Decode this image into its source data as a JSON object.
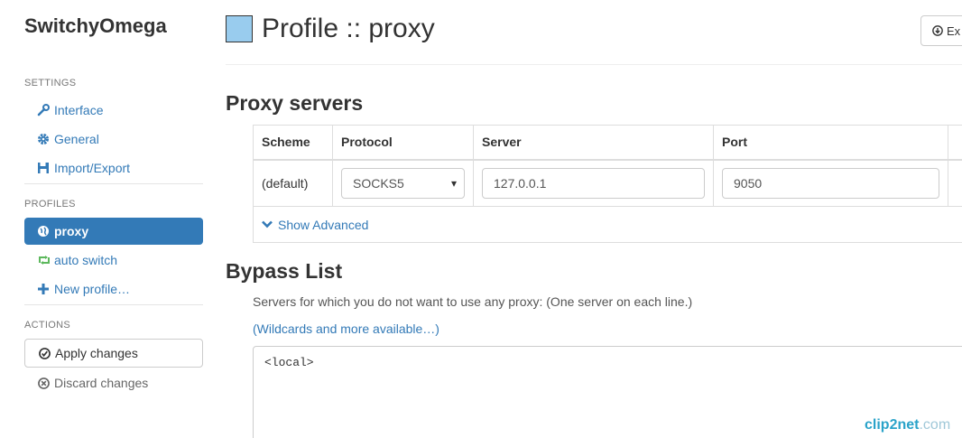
{
  "sidebar": {
    "brand": "SwitchyOmega",
    "settings_header": "SETTINGS",
    "settings_items": [
      {
        "label": "Interface",
        "icon": "wrench-icon"
      },
      {
        "label": "General",
        "icon": "gear-icon"
      },
      {
        "label": "Import/Export",
        "icon": "floppy-icon"
      }
    ],
    "profiles_header": "PROFILES",
    "profiles_items": [
      {
        "label": "proxy",
        "icon": "globe-icon",
        "active": true
      },
      {
        "label": "auto switch",
        "icon": "retweet-icon"
      },
      {
        "label": "New profile…",
        "icon": "plus-icon"
      }
    ],
    "actions_header": "ACTIONS",
    "apply_label": "Apply changes",
    "discard_label": "Discard changes"
  },
  "header": {
    "title": "Profile :: proxy",
    "export_label": "Ex",
    "swatch_color": "#99ccee"
  },
  "proxy_servers": {
    "title": "Proxy servers",
    "columns": [
      "Scheme",
      "Protocol",
      "Server",
      "Port"
    ],
    "row": {
      "scheme": "(default)",
      "protocol": "SOCKS5",
      "server": "127.0.0.1",
      "port": "9050"
    },
    "show_advanced": "Show Advanced"
  },
  "bypass": {
    "title": "Bypass List",
    "help": "Servers for which you do not want to use any proxy: (One server on each line.)",
    "link": "(Wildcards and more available…)",
    "value": "<local>"
  },
  "watermark": {
    "a": "clip2net",
    "b": ".com"
  },
  "colors": {
    "accent": "#337ab7",
    "active_bg": "#337ab7",
    "auto_switch_icon": "#5cb85c"
  }
}
